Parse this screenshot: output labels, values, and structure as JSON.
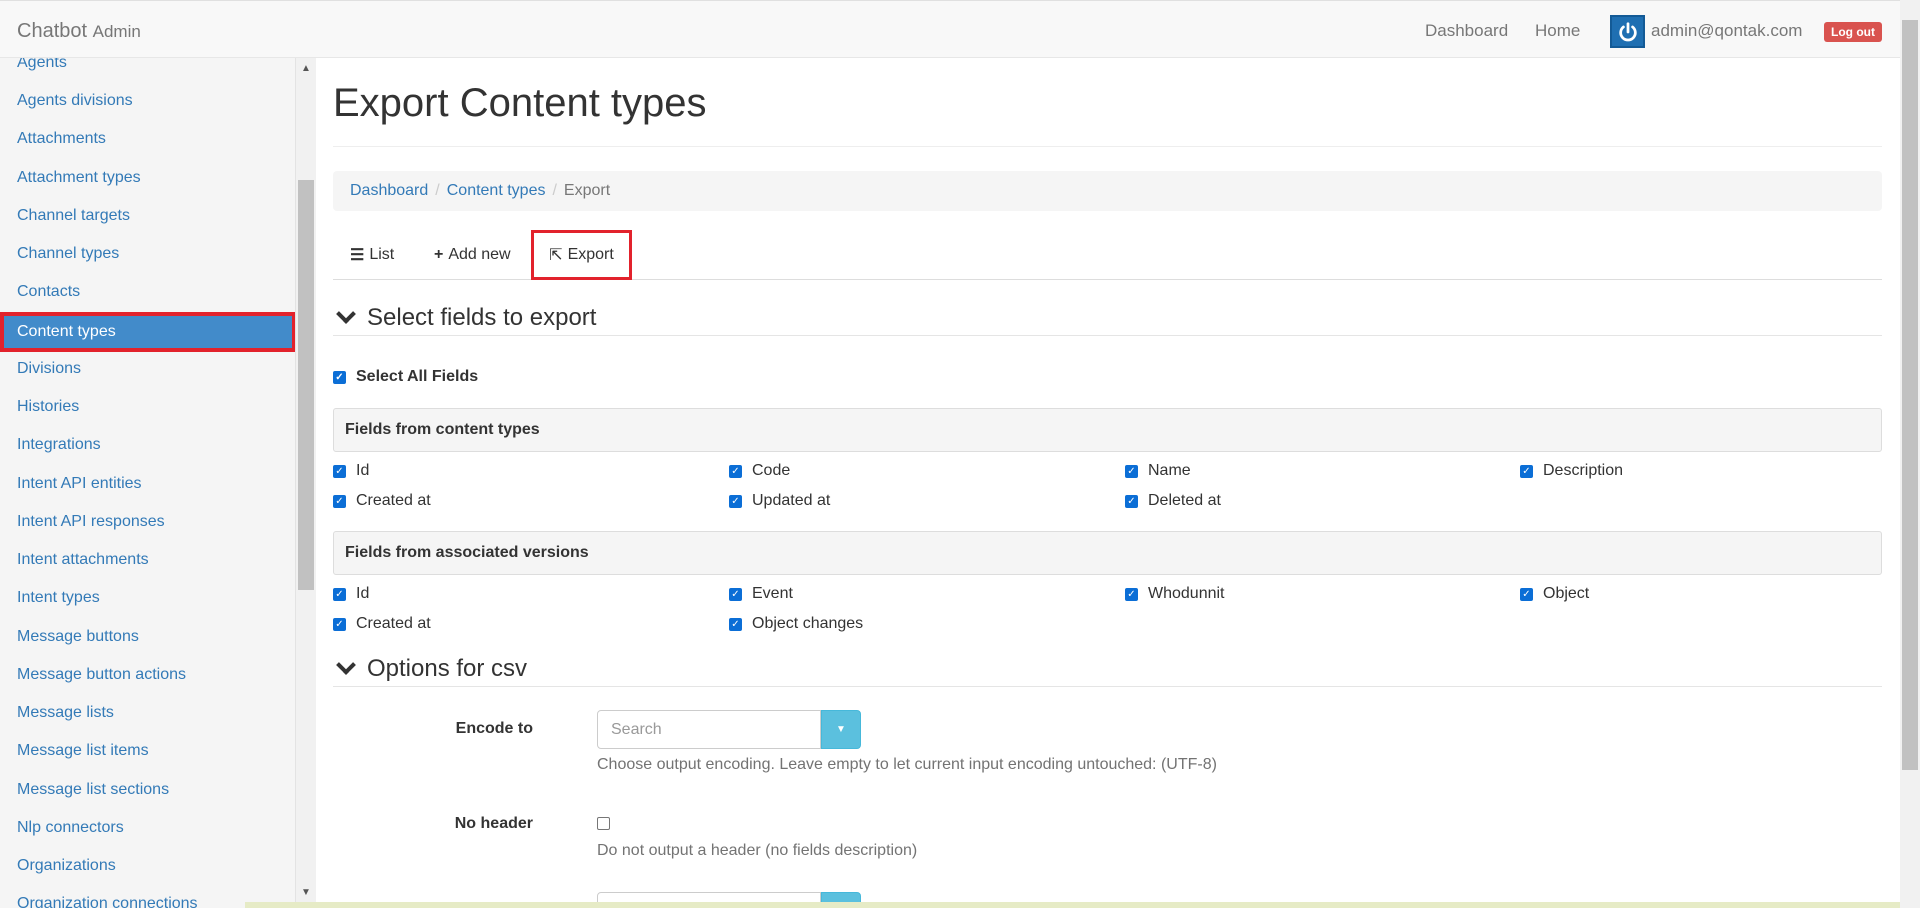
{
  "navbar": {
    "brand": "Chatbot",
    "brand_suffix": "Admin",
    "links": [
      "Dashboard",
      "Home"
    ],
    "user_email": "admin@qontak.com",
    "logout_label": "Log out"
  },
  "sidebar": {
    "items": [
      {
        "label": "Agents"
      },
      {
        "label": "Agents divisions"
      },
      {
        "label": "Attachments"
      },
      {
        "label": "Attachment types"
      },
      {
        "label": "Channel targets"
      },
      {
        "label": "Channel types"
      },
      {
        "label": "Contacts"
      },
      {
        "label": "Content types",
        "active": true
      },
      {
        "label": "Divisions"
      },
      {
        "label": "Histories"
      },
      {
        "label": "Integrations"
      },
      {
        "label": "Intent API entities"
      },
      {
        "label": "Intent API responses"
      },
      {
        "label": "Intent attachments"
      },
      {
        "label": "Intent types"
      },
      {
        "label": "Message buttons"
      },
      {
        "label": "Message button actions"
      },
      {
        "label": "Message lists"
      },
      {
        "label": "Message list items"
      },
      {
        "label": "Message list sections"
      },
      {
        "label": "Nlp connectors"
      },
      {
        "label": "Organizations"
      },
      {
        "label": "Organization connections"
      }
    ]
  },
  "page": {
    "title": "Export Content types",
    "breadcrumb": [
      "Dashboard",
      "Content types",
      "Export"
    ],
    "tabs": {
      "list": "List",
      "add_new": "Add new",
      "export": "Export"
    }
  },
  "select_fields": {
    "heading": "Select fields to export",
    "select_all_label": "Select All Fields",
    "select_all_checked": true,
    "groups": [
      {
        "title": "Fields from content types",
        "fields": [
          "Id",
          "Code",
          "Name",
          "Description",
          "Created at",
          "Updated at",
          "Deleted at"
        ]
      },
      {
        "title": "Fields from associated versions",
        "fields": [
          "Id",
          "Event",
          "Whodunnit",
          "Object",
          "Created at",
          "Object changes"
        ]
      }
    ]
  },
  "csv_options": {
    "heading": "Options for csv",
    "encode_to": {
      "label": "Encode to",
      "placeholder": "Search",
      "help": "Choose output encoding. Leave empty to let current input encoding untouched: (UTF-8)"
    },
    "no_header": {
      "label": "No header",
      "checked": false,
      "help": "Do not output a header (no fields description)"
    }
  },
  "colors": {
    "accent": "#337ab7",
    "active_bg": "#428bca",
    "highlight": "#e2222c",
    "logout": "#d9534f",
    "dropdown": "#5bc0de"
  }
}
